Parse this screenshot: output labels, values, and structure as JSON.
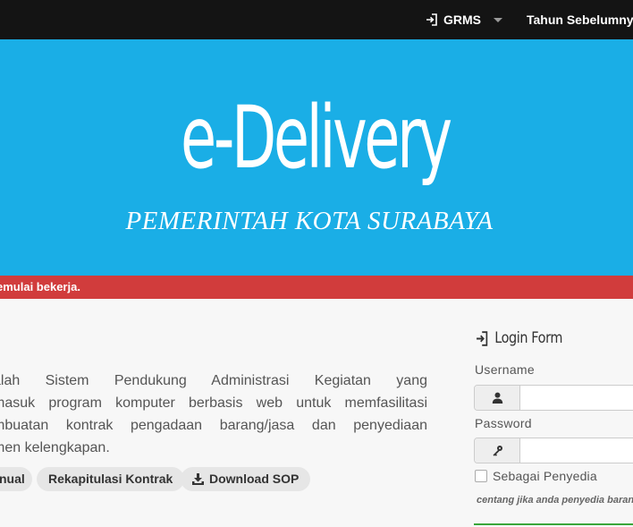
{
  "navbar": {
    "grms_label": "GRMS",
    "tahun_label": "Tahun Sebelumnya"
  },
  "banner": {
    "title": "e-Delivery",
    "subtitle": "PEMERINTAH KOTA SURABAYA"
  },
  "alert": {
    "text": "emulai bekerja."
  },
  "description": {
    "lines": [
      "alah Sistem Pendukung Administrasi Kegiatan yang",
      "masuk program komputer berbasis web untuk memfasilitasi",
      "mbuatan kontrak pengadaan barang/jasa dan penyediaan",
      "men kelengkapan."
    ]
  },
  "buttons": {
    "manual_label": "nual",
    "rekap_label": "Rekapitulasi Kontrak",
    "sop_label": "Download SOP"
  },
  "login": {
    "title": "Login Form",
    "username_label": "Username",
    "password_label": "Password",
    "penyedia_label": "Sebagai Penyedia",
    "hint": "centang jika anda penyedia barang/jasa"
  },
  "colors": {
    "topbar": "#141414",
    "banner": "#1aaee6",
    "alert": "#d13c3c"
  },
  "icons": [
    "sign-in-icon",
    "caret-down-icon",
    "download-icon",
    "user-icon",
    "key-icon"
  ]
}
